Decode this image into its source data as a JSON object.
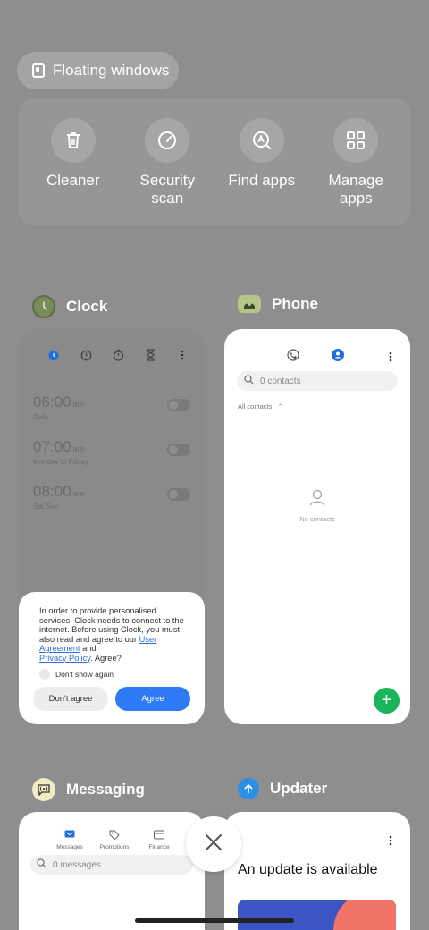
{
  "floating_windows": {
    "label": "Floating windows"
  },
  "tools": [
    {
      "label": "Cleaner",
      "icon": "trash-icon"
    },
    {
      "label": "Security scan",
      "icon": "security-gauge-icon"
    },
    {
      "label": "Find apps",
      "icon": "find-apps-icon"
    },
    {
      "label": "Manage apps",
      "icon": "grid-icon"
    }
  ],
  "apps": {
    "clock": {
      "name": "Clock",
      "alarms": [
        {
          "time": "06:00",
          "ampm": "am",
          "repeat": "Daily"
        },
        {
          "time": "07:00",
          "ampm": "am",
          "repeat": "Monday to Friday"
        },
        {
          "time": "08:00",
          "ampm": "am",
          "repeat": "Sat Sun"
        }
      ],
      "dialog": {
        "text_1": "In order to provide personalised services, Clock needs to connect to the internet. Before using Clock, you must also read and agree to our ",
        "link_1": "User Agreement",
        "text_2": " and ",
        "link_2": "Privacy Policy",
        "text_3": ". Agree?",
        "checkbox_label": "Don't show again",
        "disagree_label": "Don't agree",
        "agree_label": "Agree"
      }
    },
    "phone": {
      "name": "Phone",
      "search_placeholder": "0 contacts",
      "filter_label": "All contacts",
      "empty_label": "No contacts",
      "fab_label": "+"
    },
    "messaging": {
      "name": "Messaging",
      "tabs": [
        "Messages",
        "Promotions",
        "Finance"
      ],
      "search_placeholder": "0 messages"
    },
    "updater": {
      "name": "Updater",
      "title": "An update is available"
    }
  },
  "colors": {
    "background": "#8e8e8e",
    "accent_blue": "#2f7bf5",
    "fab_green": "#18b55a",
    "link": "#2f6bd6"
  }
}
